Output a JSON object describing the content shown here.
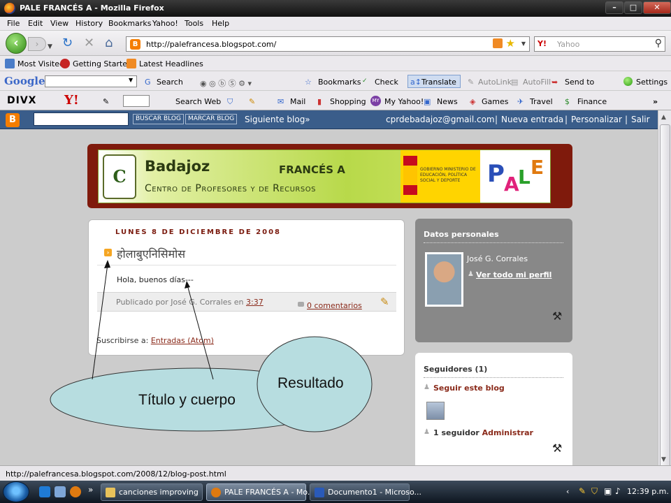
{
  "window": {
    "title": "PALE FRANCÉS A - Mozilla Firefox",
    "min": "–",
    "max": "□",
    "close": "✕"
  },
  "menu": [
    "File",
    "Edit",
    "View",
    "History",
    "Bookmarks",
    "Yahoo!",
    "Tools",
    "Help"
  ],
  "nav": {
    "url": "http://palefrancesa.blogspot.com/",
    "search_engine": "Y!",
    "search_placeholder": "Yahoo"
  },
  "bookmarks": [
    "Most Visited",
    "Getting Started",
    "Latest Headlines"
  ],
  "google_toolbar": {
    "logo": "Google",
    "search": "Search",
    "bookmarks": "Bookmarks",
    "check": "Check",
    "translate": "Translate",
    "autolink": "AutoLink",
    "autofill": "AutoFill",
    "sendto": "Send to",
    "settings": "Settings"
  },
  "yahoo_toolbar": {
    "divx": "DIVX",
    "yahoo": "Y!",
    "search_web": "Search Web",
    "mail": "Mail",
    "shopping": "Shopping",
    "my_yahoo": "My Yahoo!",
    "news": "News",
    "games": "Games",
    "travel": "Travel",
    "finance": "Finance"
  },
  "blogger_nav": {
    "search_btn": "BUSCAR BLOG",
    "flag_btn": "MARCAR BLOG",
    "next": "Siguiente blog»",
    "email": "cprdebadajoz@gmail.com",
    "new_post": "Nueva entrada",
    "customize": "Personalizar",
    "logout": "Salir",
    "sep": "|"
  },
  "banner": {
    "city": "Badajoz",
    "course": "FRANCÉS A",
    "centro": "Centro de Profesores y de Recursos",
    "ministry": "GOBIERNO MINISTERIO DE EDUCACIÓN, POLÍTICA SOCIAL Y DEPORTE",
    "logo_letter": "C",
    "pale": [
      "P",
      "A",
      "L",
      "E"
    ]
  },
  "post": {
    "date": "LUNES 8 DE DICIEMBRE DE 2008",
    "title": "होलाबुएनिसिमोस",
    "body": "Hola, buenos días---",
    "published_by": "Publicado por José G. Corrales en ",
    "time": "3:37",
    "comments": "0 comentarios",
    "subscribe_label": "Suscribirse a: ",
    "subscribe_link": "Entradas (Atom)"
  },
  "profile": {
    "heading": "Datos personales",
    "name": "José G. Corrales",
    "view_all": "Ver todo mi perfil"
  },
  "followers": {
    "heading": "Seguidores (1)",
    "follow": "Seguir este blog",
    "count": "1 seguidor",
    "admin": "Administrar"
  },
  "annotations": {
    "title_body": "Título y cuerpo",
    "result": "Resultado"
  },
  "status": "http://palefrancesa.blogspot.com/2008/12/blog-post.html",
  "taskbar": {
    "tasks": [
      "canciones improving",
      "PALE FRANCÉS A - Mo...",
      "Documento1 - Microso..."
    ],
    "clock": "12:39 p.m."
  }
}
